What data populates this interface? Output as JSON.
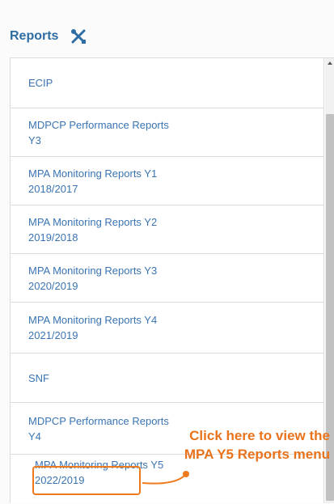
{
  "panel": {
    "title": "Reports",
    "header_icon": "tools-icon"
  },
  "reports": [
    {
      "line1": "ECIP",
      "line2": ""
    },
    {
      "line1": "MDPCP Performance Reports",
      "line2": "Y3"
    },
    {
      "line1": "MPA Monitoring Reports Y1",
      "line2": "2018/2017"
    },
    {
      "line1": "MPA Monitoring Reports Y2",
      "line2": "2019/2018"
    },
    {
      "line1": "MPA Monitoring Reports Y3",
      "line2": "2020/2019"
    },
    {
      "line1": "MPA Monitoring Reports Y4",
      "line2": "2021/2019"
    },
    {
      "line1": "SNF",
      "line2": ""
    },
    {
      "line1": "MDPCP Performance Reports",
      "line2": "Y4"
    },
    {
      "line1": "MPA Monitoring Reports Y5",
      "line2": "2022/2019"
    }
  ],
  "annotation": {
    "line1": "Click here to view the",
    "line2": "MPA Y5 Reports menu"
  },
  "colors": {
    "link": "#3a74b3",
    "title": "#2e6da4",
    "annotation": "#e8731c"
  }
}
